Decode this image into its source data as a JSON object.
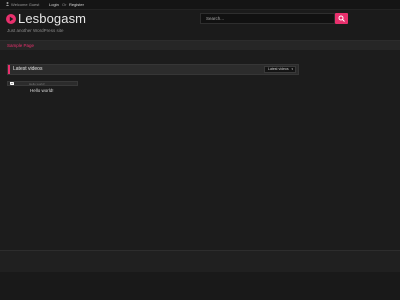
{
  "topbar": {
    "welcome_text": "Welcome Guest",
    "login_label": "Login",
    "or_text": "Or",
    "register_label": "Register"
  },
  "header": {
    "site_title": "Lesbogasm",
    "tagline": "Just another WordPress site",
    "search": {
      "placeholder": "Search...",
      "value": ""
    }
  },
  "nav": {
    "items": [
      {
        "label": "Sample Page"
      }
    ]
  },
  "main": {
    "widget": {
      "title": "Latest videos",
      "filter": {
        "selected": "Latest videos"
      }
    },
    "posts": [
      {
        "image_alt": "Hello world!",
        "title": "Hello world!"
      }
    ]
  },
  "colors": {
    "accent": "#e8306d",
    "background": "#1e1e1e"
  },
  "icons": [
    "user-icon",
    "play-circle-icon",
    "search-icon",
    "chevron-down-icon",
    "broken-image-icon"
  ]
}
